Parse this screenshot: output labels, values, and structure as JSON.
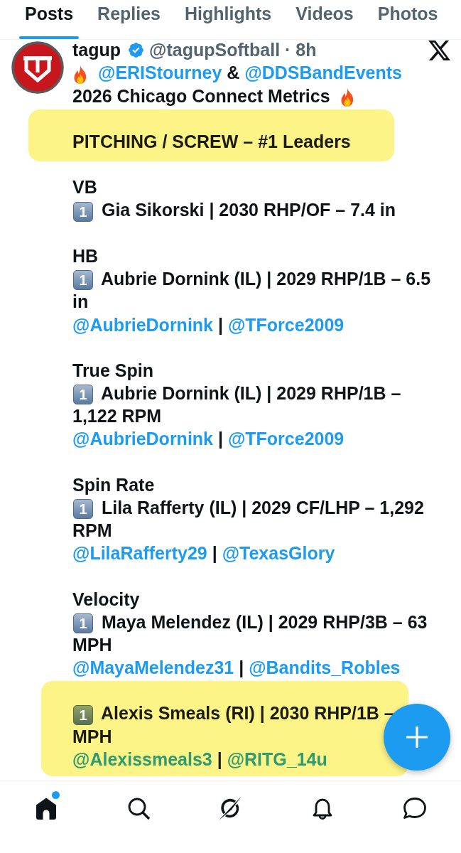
{
  "tabs": [
    {
      "label": "Posts",
      "selected": true
    },
    {
      "label": "Replies",
      "selected": false
    },
    {
      "label": "Highlights",
      "selected": false
    },
    {
      "label": "Videos",
      "selected": false
    },
    {
      "label": "Photos",
      "selected": false
    }
  ],
  "post": {
    "author": {
      "name": "tagup",
      "verified": true,
      "handle": "@tagupSoftball",
      "separator": "·",
      "time": "8h"
    },
    "intro": [
      {
        "kind": "link",
        "text": "@ERIStourney"
      },
      {
        "kind": "text",
        "text": "&"
      },
      {
        "kind": "link",
        "text": "@DDSBandEvents"
      }
    ],
    "title": "2026 Chicago Connect Metrics",
    "heading": {
      "text": "PITCHING / SCREW – #1 Leaders",
      "highlighted": true
    },
    "sections": [
      {
        "label": "VB",
        "rank": "1",
        "leader": "Gia Sikorski | 2030 RHP/OF – 7.4 in",
        "highlighted": false
      },
      {
        "label": "HB",
        "rank": "1",
        "leader": "Aubrie Dornink (IL) | 2029 RHP/1B – 6.5 in",
        "handles": [
          {
            "kind": "link",
            "text": "@AubrieDornink"
          },
          {
            "kind": "text",
            "text": "|"
          },
          {
            "kind": "link",
            "text": "@TForce2009"
          }
        ],
        "highlighted": false
      },
      {
        "label": "True Spin",
        "rank": "1",
        "leader": "Aubrie Dornink (IL) | 2029 RHP/1B – 1,122 RPM",
        "handles": [
          {
            "kind": "link",
            "text": "@AubrieDornink"
          },
          {
            "kind": "text",
            "text": "|"
          },
          {
            "kind": "link",
            "text": "@TForce2009"
          }
        ],
        "highlighted": false
      },
      {
        "label": "Spin Rate",
        "rank": "1",
        "leader": "Lila Rafferty (IL) | 2029 CF/LHP – 1,292 RPM",
        "handles": [
          {
            "kind": "link",
            "text": "@LilaRafferty29"
          },
          {
            "kind": "text",
            "text": "|"
          },
          {
            "kind": "link",
            "text": "@TexasGlory"
          }
        ],
        "highlighted": false
      },
      {
        "label": "Velocity",
        "rank": "1",
        "leader": "Maya Melendez (IL) | 2029 RHP/3B – 63 MPH",
        "handles": [
          {
            "kind": "link",
            "text": "@MayaMelendez31"
          },
          {
            "kind": "text",
            "text": "|"
          },
          {
            "kind": "link",
            "text": "@Bandits_Robles"
          }
        ],
        "highlighted": false
      },
      {
        "rank": "1",
        "leader": "Alexis Smeals (RI) | 2030 RHP/1B –",
        "leader_end": "MPH",
        "handles": [
          {
            "kind": "link",
            "text": "@Alexissmeals3"
          },
          {
            "kind": "text",
            "text": "|"
          },
          {
            "kind": "link",
            "text": "@RITG_14u"
          }
        ],
        "highlighted": true
      }
    ]
  },
  "nav": [
    {
      "kind": "home",
      "selected": true,
      "badge": true
    },
    {
      "kind": "search",
      "selected": false,
      "badge": false
    },
    {
      "kind": "grok",
      "selected": false,
      "badge": false
    },
    {
      "kind": "notifications",
      "selected": false,
      "badge": false
    },
    {
      "kind": "messages",
      "selected": false,
      "badge": false
    }
  ]
}
